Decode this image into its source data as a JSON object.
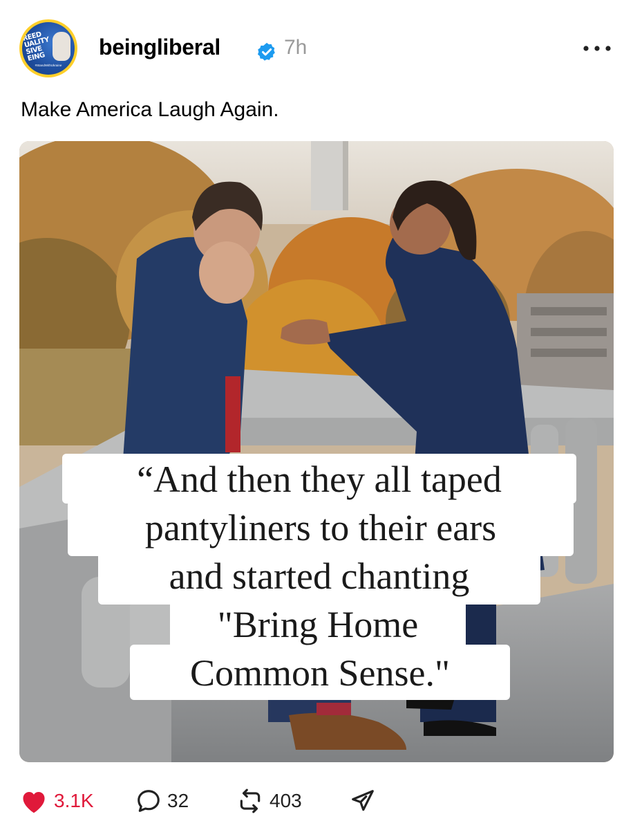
{
  "post": {
    "username": "beingliberal",
    "time": "7h",
    "caption": "Make America Laugh Again.",
    "avatar": {
      "text_lines": [
        "REED",
        "UALITY",
        "SIVE",
        "EING"
      ],
      "tag": "#StandWithUkraine",
      "ring_color": "#ffcf2a",
      "bg_color": "#1f4fa0"
    },
    "verified_badge_color": "#1d9bf0",
    "more_icon": "ellipsis-icon",
    "image": {
      "quote_lines": [
        "“And then they all taped",
        "pantyliners to their ears",
        "and started chanting",
        "\"Bring Home",
        "Common Sense.\""
      ]
    },
    "actions": {
      "like": {
        "icon": "heart-icon",
        "count": "3.1K",
        "color": "#e0193a"
      },
      "reply": {
        "icon": "speech-bubble-icon",
        "count": "32"
      },
      "repost": {
        "icon": "repost-icon",
        "count": "403"
      },
      "share": {
        "icon": "paper-plane-icon"
      }
    }
  }
}
